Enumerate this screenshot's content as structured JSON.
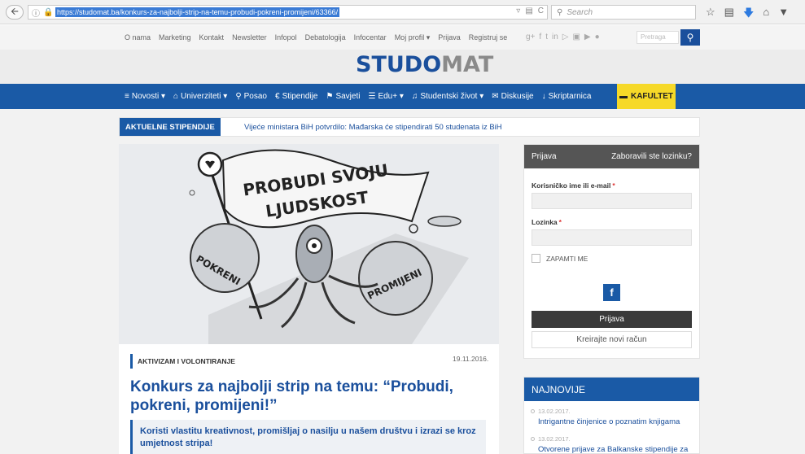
{
  "browser": {
    "url": "https://studomat.ba/konkurs-za-najbolji-strip-na-temu-probudi-pokreni-promijeni/63366/",
    "search_placeholder": "Search"
  },
  "toplinks": [
    "O nama",
    "Marketing",
    "Kontakt",
    "Newsletter",
    "Infopol",
    "Debatologija",
    "Infocentar",
    "Moj profil ▾",
    "Prijava",
    "Registruj se"
  ],
  "top_search_placeholder": "Pretraga",
  "logo": {
    "part1": "STUDO",
    "part2": "MAT"
  },
  "nav": {
    "items": [
      "Novosti ▾",
      "Univerziteti ▾",
      "Posao",
      "Stipendije",
      "Savjeti",
      "Edu+ ▾",
      "Studentski život ▾",
      "Diskusije",
      "Skriptarnica"
    ],
    "highlight": "KAFULTET"
  },
  "ticker": {
    "tag": "AKTUELNE STIPENDIJE",
    "headline": "Vijeće ministara BiH potvrdilo: Mađarska će stipendirati 50 studenata iz BiH"
  },
  "article": {
    "hero": {
      "flag_line1": "PROBUDI SVOJU",
      "flag_line2": "LJUDSKOST",
      "left_word": "POKRENI",
      "right_word": "PROMIJENI"
    },
    "category": "AKTIVIZAM I VOLONTIRANJE",
    "date": "19.11.2016.",
    "title": "Konkurs za najbolji strip na temu: “Probudi, pokreni, promijeni!”",
    "lead": "Koristi vlastitu kreativnost, promišljaj o nasilju u našem društvu i izrazi se kroz umjetnost stripa!"
  },
  "login": {
    "title": "Prijava",
    "forgot": "Zaboravili ste lozinku?",
    "username_label": "Korisničko ime ili e-mail",
    "password_label": "Lozinka",
    "required_mark": "*",
    "remember": "ZAPAMTI ME",
    "fb": "f",
    "submit": "Prijava",
    "register": "Kreirajte novi račun"
  },
  "latest": {
    "title": "NAJNOVIJE",
    "items": [
      {
        "date": "13.02.2017.",
        "title": "Intrigantne činjenice o poznatim knjigama"
      },
      {
        "date": "13.02.2017.",
        "title": "Otvorene prijave za Balkanske stipendije za"
      }
    ]
  },
  "colors": {
    "brand_blue": "#1a5aa6",
    "highlight_yellow": "#f6d928",
    "login_head": "#555555"
  }
}
